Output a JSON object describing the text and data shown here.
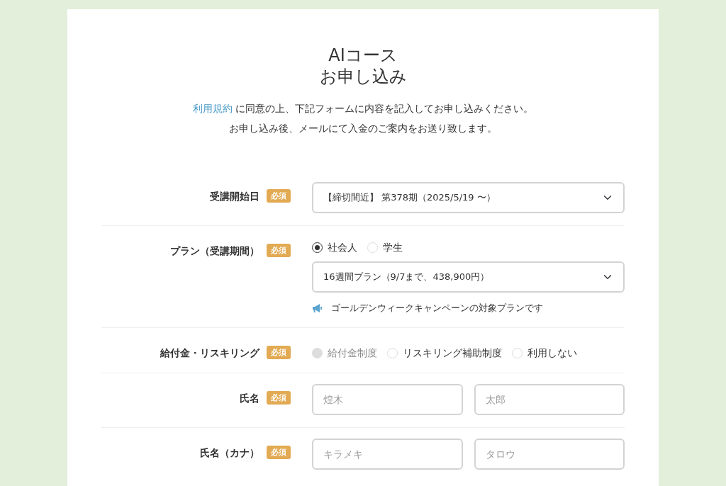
{
  "title_lines": [
    "AIコース",
    "お申し込み"
  ],
  "intro": {
    "link": "利用規約",
    "text": " に同意の上、下記フォームに内容を記入してお申し込みください。",
    "line2": "お申し込み後、メールにて入金のご案内をお送り致します。"
  },
  "rows": [
    {
      "kind": "select",
      "label": "受講開始日",
      "badge": "必須",
      "value": "【締切間近】 第378期（2025/5/19 〜）"
    },
    {
      "kind": "plan",
      "label": "プラン（受講期間）",
      "badge": "必須",
      "options": [
        {
          "label": "社会人",
          "selected": true,
          "disabled": false
        },
        {
          "label": "学生",
          "selected": false,
          "disabled": false
        }
      ],
      "value": "16週間プラン（9/7まで、438,900円）",
      "note": "ゴールデンウィークキャンペーンの対象プランです"
    },
    {
      "kind": "radio",
      "label": "給付金・リスキリング",
      "badge": "必須",
      "options": [
        {
          "label": "給付金制度",
          "selected": false,
          "disabled": true
        },
        {
          "label": "リスキリング補助制度",
          "selected": false,
          "disabled": false
        },
        {
          "label": "利用しない",
          "selected": false,
          "disabled": false
        }
      ]
    },
    {
      "kind": "inputs",
      "label": "氏名",
      "badge": "必須",
      "fields": [
        {
          "placeholder": "煌木"
        },
        {
          "placeholder": "太郎"
        }
      ]
    },
    {
      "kind": "inputs",
      "label": "氏名（カナ）",
      "badge": "必須",
      "fields": [
        {
          "placeholder": "キラメキ"
        },
        {
          "placeholder": "タロウ"
        }
      ]
    }
  ]
}
